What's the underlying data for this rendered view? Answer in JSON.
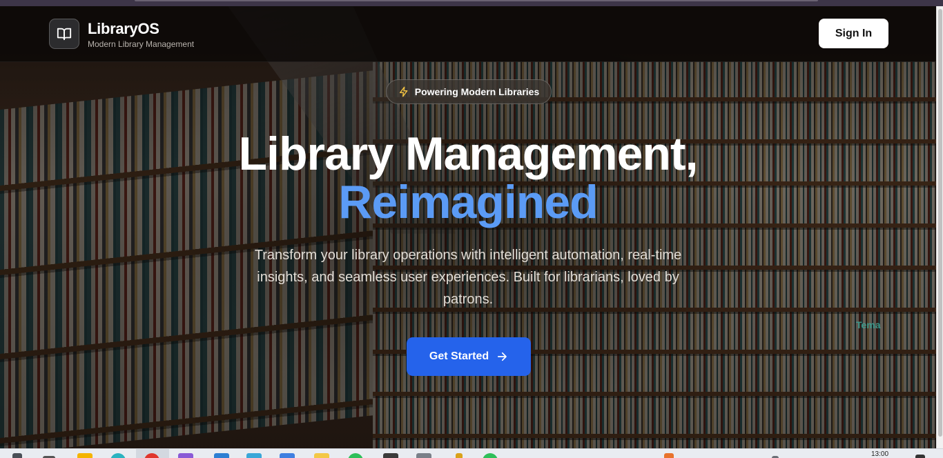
{
  "header": {
    "brand_name": "LibraryOS",
    "brand_tagline": "Modern Library Management",
    "sign_in_label": "Sign In"
  },
  "hero": {
    "badge_label": "Powering Modern Libraries",
    "title_line1": "Library Management,",
    "title_line2": "Reimagined",
    "description": "Transform your library operations with intelligent automation, real-time insights, and seamless user experiences. Built for librarians, loved by patrons.",
    "cta_label": "Get Started"
  },
  "background": {
    "shelf_sign": "Tema"
  },
  "taskbar": {
    "clock": "13:00"
  },
  "colors": {
    "accent_blue": "#2563eb",
    "title_accent": "#5b9bf5",
    "badge_icon": "#f5c542"
  },
  "icons": {
    "logo": "open-book-icon",
    "badge": "lightning-icon",
    "cta": "arrow-right-icon"
  }
}
